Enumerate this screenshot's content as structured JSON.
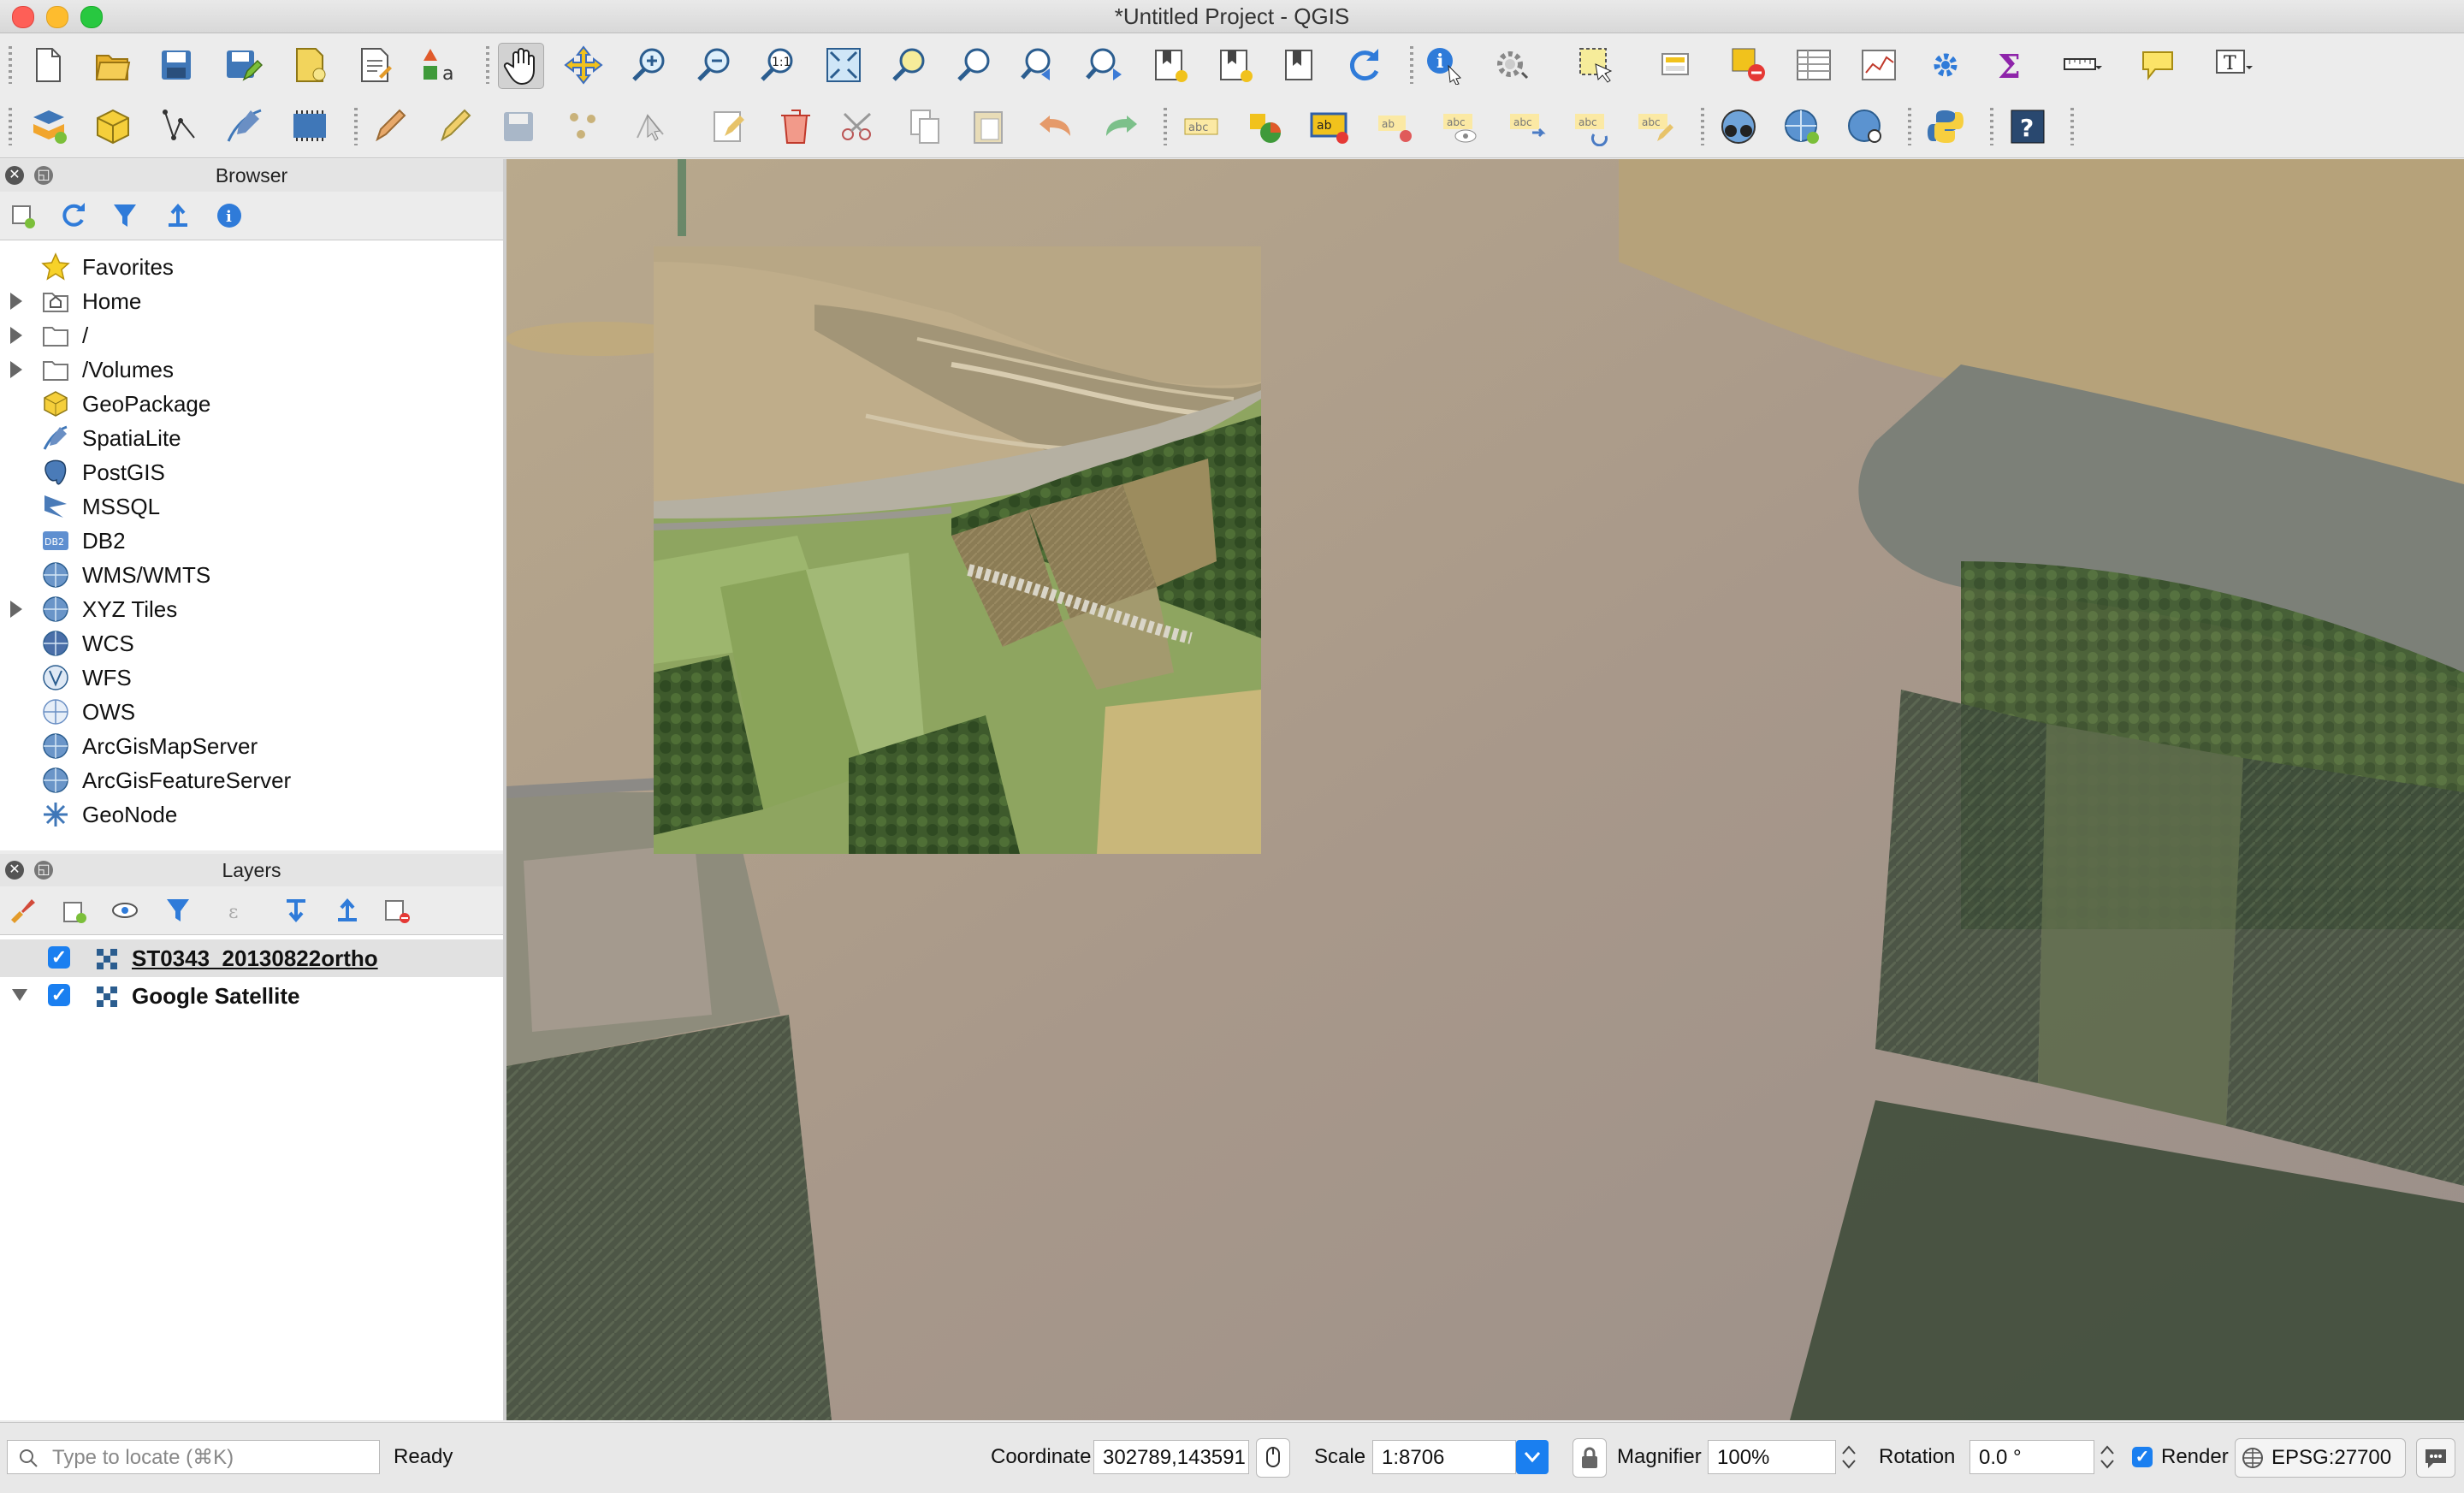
{
  "window": {
    "title": "*Untitled Project - QGIS",
    "controls": [
      "close",
      "minimize",
      "zoom"
    ]
  },
  "toolbar1": {
    "icons": [
      "new-project-icon",
      "open-project-icon",
      "save-project-icon",
      "save-as-icon",
      "new-print-layout-icon",
      "layout-manager-icon",
      "style-manager-icon",
      "pan-icon",
      "pan-to-selection-icon",
      "zoom-in-icon",
      "zoom-out-icon",
      "zoom-native-icon",
      "zoom-full-icon",
      "zoom-to-selection-icon",
      "zoom-to-layer-icon",
      "zoom-last-icon",
      "zoom-next-icon",
      "new-bookmark-icon",
      "show-bookmarks-icon",
      "spatial-bookmarks-icon",
      "refresh-icon",
      "identify-icon",
      "run-action-icon",
      "select-features-icon",
      "select-by-value-icon",
      "deselect-icon",
      "attribute-table-icon",
      "statistics-icon",
      "toolbox-icon",
      "field-calculator-icon",
      "measure-icon",
      "map-tips-icon",
      "text-annotation-icon"
    ]
  },
  "toolbar2": {
    "icons": [
      "data-source-manager-icon",
      "new-geopackage-icon",
      "digitize-vertex-icon",
      "digitize-line-icon",
      "new-spatialite-icon",
      "current-edits-icon",
      "toggle-editing-icon",
      "save-edits-icon",
      "add-feature-icon",
      "vertex-tool-icon",
      "modify-attributes-icon",
      "delete-selected-icon",
      "cut-features-icon",
      "copy-features-icon",
      "paste-features-icon",
      "undo-icon",
      "redo-icon",
      "label-icon",
      "diagram-icon",
      "highlight-label-icon",
      "pin-label-icon",
      "show-hide-label-icon",
      "move-label-icon",
      "rotate-label-icon",
      "change-label-icon",
      "osm-icon",
      "add-wms-icon",
      "search-wms-icon",
      "python-console-icon",
      "help-icon"
    ]
  },
  "browser": {
    "title": "Browser",
    "items": [
      {
        "label": "Favorites",
        "expandable": false,
        "icon": "star-icon"
      },
      {
        "label": "Home",
        "expandable": true,
        "icon": "home-folder-icon"
      },
      {
        "label": "/",
        "expandable": true,
        "icon": "folder-icon"
      },
      {
        "label": "/Volumes",
        "expandable": true,
        "icon": "folder-icon"
      },
      {
        "label": "GeoPackage",
        "expandable": false,
        "icon": "geopackage-icon"
      },
      {
        "label": "SpatiaLite",
        "expandable": false,
        "icon": "spatialite-icon"
      },
      {
        "label": "PostGIS",
        "expandable": false,
        "icon": "postgis-icon"
      },
      {
        "label": "MSSQL",
        "expandable": false,
        "icon": "mssql-icon"
      },
      {
        "label": "DB2",
        "expandable": false,
        "icon": "db2-icon"
      },
      {
        "label": "WMS/WMTS",
        "expandable": false,
        "icon": "globe-icon"
      },
      {
        "label": "XYZ Tiles",
        "expandable": true,
        "icon": "globe-icon"
      },
      {
        "label": "WCS",
        "expandable": false,
        "icon": "globe-icon"
      },
      {
        "label": "WFS",
        "expandable": false,
        "icon": "globe-icon"
      },
      {
        "label": "OWS",
        "expandable": false,
        "icon": "globe-icon"
      },
      {
        "label": "ArcGisMapServer",
        "expandable": false,
        "icon": "globe-icon"
      },
      {
        "label": "ArcGisFeatureServer",
        "expandable": false,
        "icon": "globe-icon"
      },
      {
        "label": "GeoNode",
        "expandable": false,
        "icon": "geonode-icon"
      }
    ]
  },
  "layers": {
    "title": "Layers",
    "items": [
      {
        "label": "ST0343_20130822ortho",
        "checked": true,
        "selected": true
      },
      {
        "label": "Google Satellite",
        "checked": true,
        "selected": false
      }
    ]
  },
  "statusbar": {
    "locate_placeholder": "Type to locate (⌘K)",
    "status": "Ready",
    "coordinate_label": "Coordinate",
    "coordinate_value": "302789,143591",
    "scale_label": "Scale",
    "scale_value": "1:8706",
    "magnifier_label": "Magnifier",
    "magnifier_value": "100%",
    "rotation_label": "Rotation",
    "rotation_value": "0.0 °",
    "render_label": "Render",
    "render_checked": true,
    "crs": "EPSG:27700"
  },
  "colors": {
    "accent": "#1a7ff0",
    "close": "#fe5f57",
    "minimize": "#febc2e",
    "zoom": "#28c840"
  }
}
